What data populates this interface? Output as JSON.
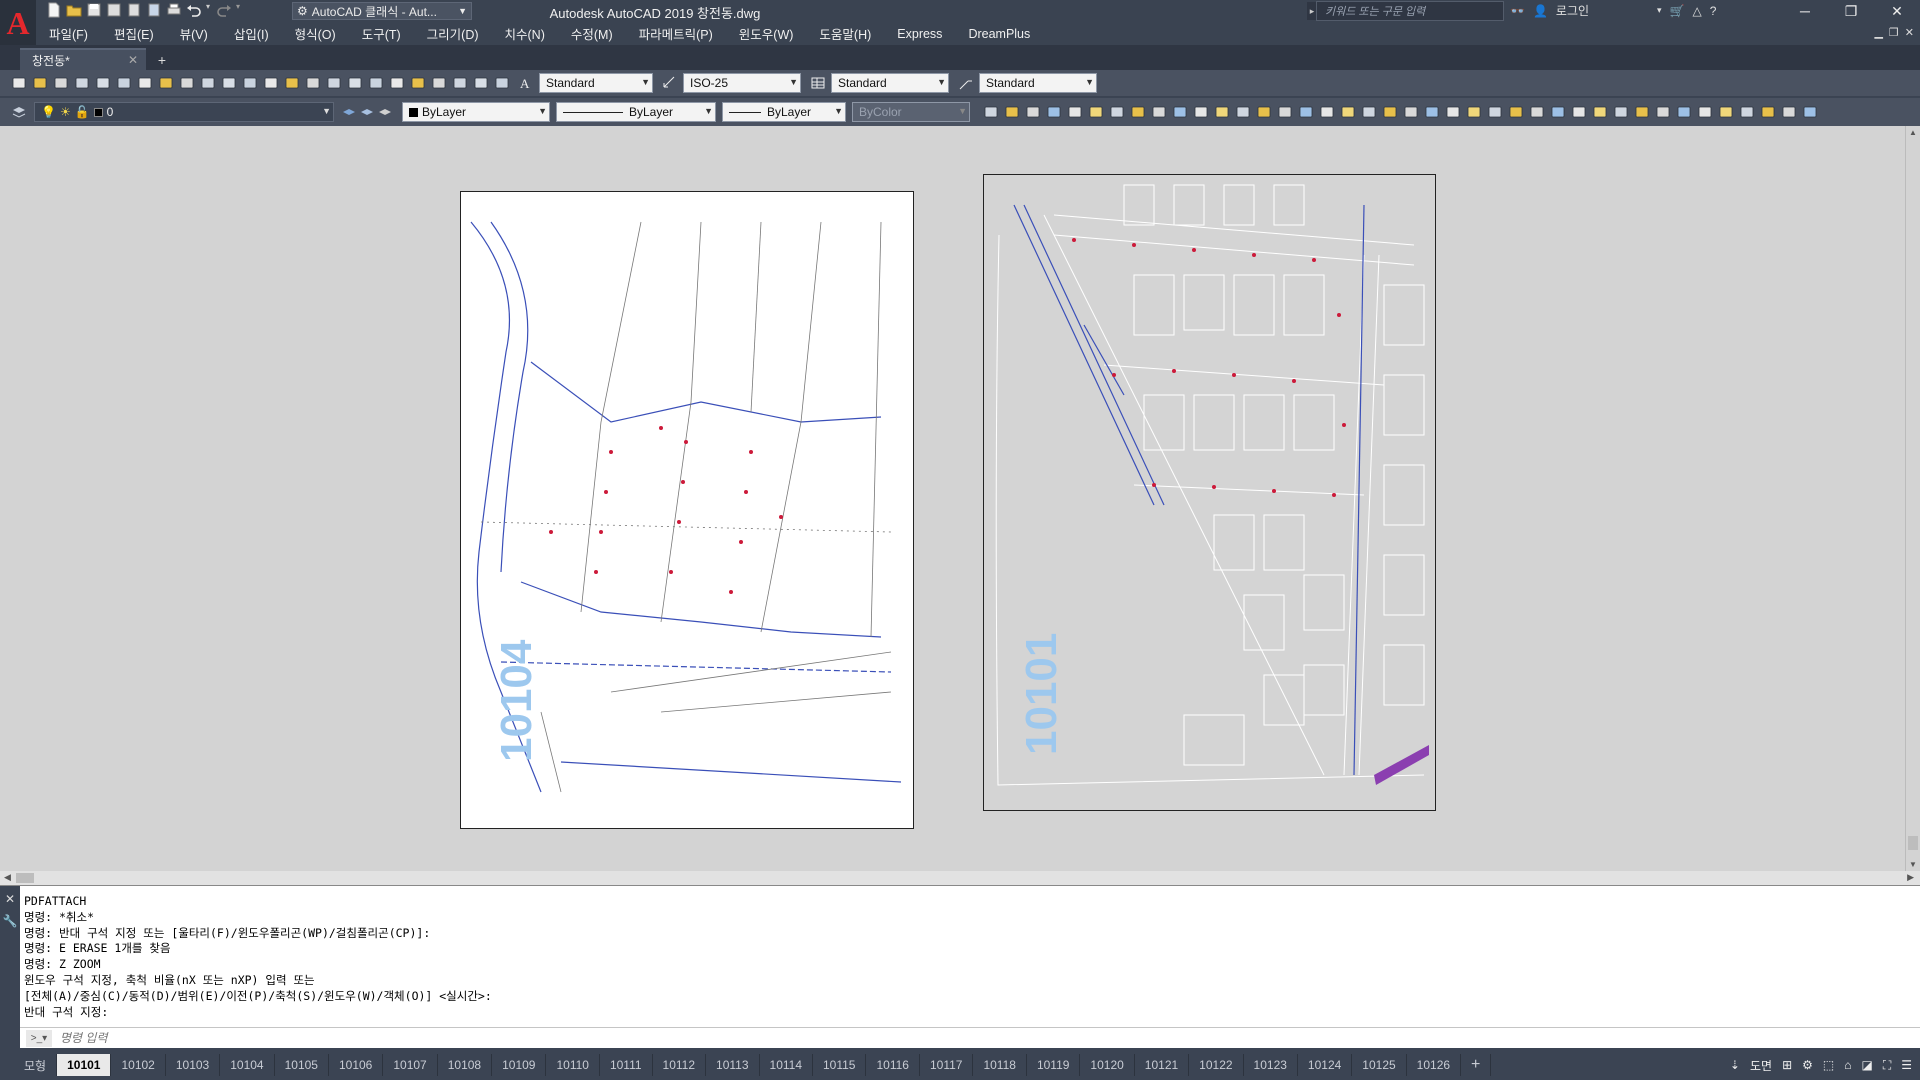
{
  "app": {
    "logo": "A",
    "workspace": "AutoCAD 클래식 - Aut...",
    "title": "Autodesk AutoCAD 2019    창전동.dwg",
    "search_placeholder": "키워드 또는 구문 입력",
    "login": "로그인"
  },
  "menu": [
    "파일(F)",
    "편집(E)",
    "뷰(V)",
    "삽입(I)",
    "형식(O)",
    "도구(T)",
    "그리기(D)",
    "치수(N)",
    "수정(M)",
    "파라메트릭(P)",
    "윈도우(W)",
    "도움말(H)",
    "Express",
    "DreamPlus"
  ],
  "doc_tab": {
    "label": "창전동*"
  },
  "toolbar": {
    "text_style": "Standard",
    "dim_style": "ISO-25",
    "table_style": "Standard",
    "mleader_style": "Standard",
    "layer": "0",
    "color": "ByLayer",
    "linetype": "ByLayer",
    "lineweight": "ByLayer",
    "plotstyle": "ByColor"
  },
  "sheets": {
    "left_label": "10104",
    "right_label": "10101"
  },
  "command_history": [
    "PDFATTACH",
    "명령: *취소*",
    "명령: 반대 구석 지정 또는 [울타리(F)/윈도우폴리곤(WP)/걸침폴리곤(CP)]:",
    "명령: E ERASE 1개를 찾음",
    "명령: Z ZOOM",
    "윈도우 구석 지정, 축척 비율(nX 또는 nXP) 입력 또는",
    "[전체(A)/중심(C)/동적(D)/범위(E)/이전(P)/축척(S)/윈도우(W)/객체(O)] <실시간>:",
    "반대 구석 지정:"
  ],
  "command_placeholder": "명령 입력",
  "layout_tabs": [
    "모형",
    "10101",
    "10102",
    "10103",
    "10104",
    "10105",
    "10106",
    "10107",
    "10108",
    "10109",
    "10110",
    "10111",
    "10112",
    "10113",
    "10114",
    "10115",
    "10116",
    "10117",
    "10118",
    "10119",
    "10120",
    "10121",
    "10122",
    "10123",
    "10124",
    "10125",
    "10126"
  ],
  "status": {
    "paper_label": "도면"
  }
}
